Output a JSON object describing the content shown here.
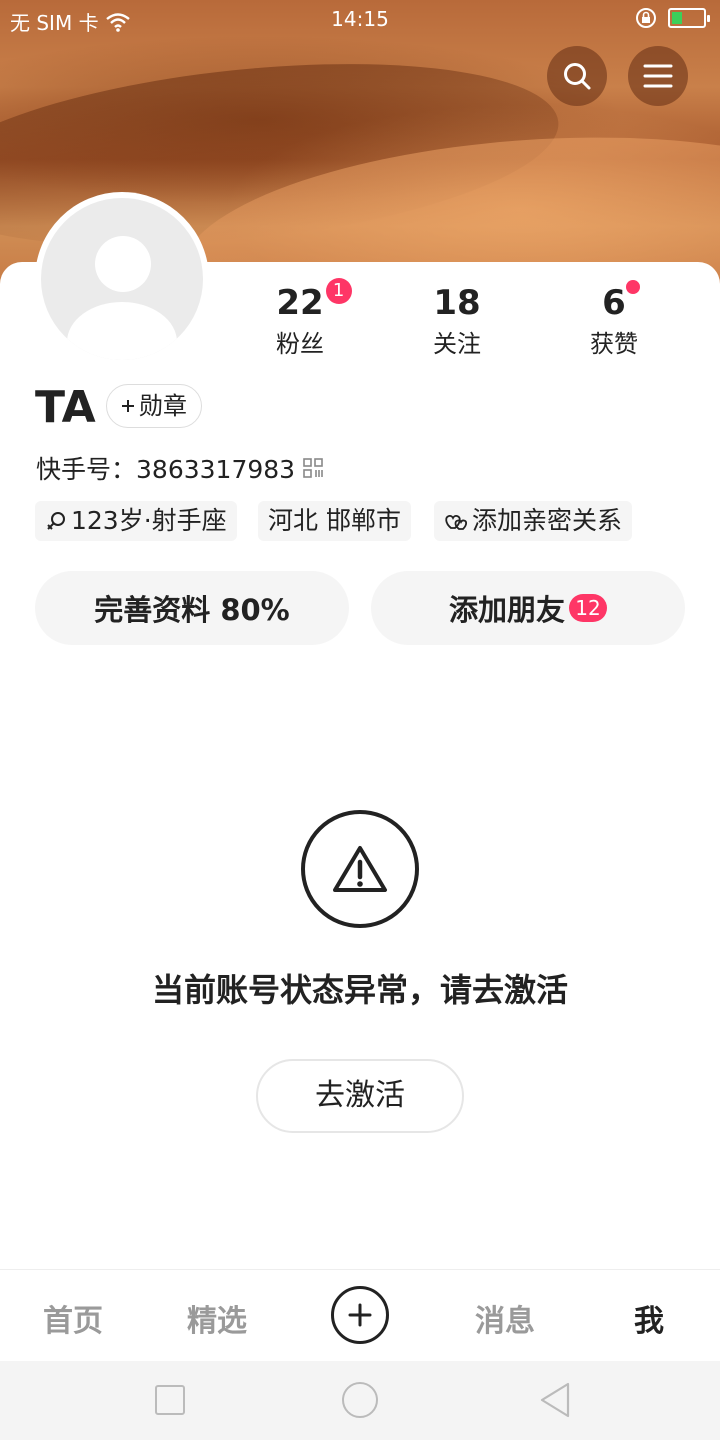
{
  "status_bar": {
    "carrier": "无 SIM 卡",
    "time": "14:15"
  },
  "profile": {
    "name": "TA",
    "medal_label": "勋章",
    "kuaishou_id_label": "快手号：",
    "kuaishou_id": "3863317983",
    "stats": {
      "fans": {
        "count": "22",
        "label": "粉丝",
        "badge": "1"
      },
      "following": {
        "count": "18",
        "label": "关注"
      },
      "likes": {
        "count": "6",
        "label": "获赞"
      }
    },
    "tags": {
      "age_sign": "123岁·射手座",
      "location": "河北 邯郸市",
      "intimate": "添加亲密关系"
    }
  },
  "actions": {
    "complete_profile": "完善资料 80%",
    "add_friends": "添加朋友",
    "add_friends_badge": "12"
  },
  "warning": {
    "message": "当前账号状态异常，请去激活",
    "button": "去激活"
  },
  "tabbar": {
    "home": "首页",
    "featured": "精选",
    "messages": "消息",
    "me": "我"
  },
  "colors": {
    "accent": "#fe3666",
    "text": "#222222",
    "muted": "#9a9a9a"
  }
}
